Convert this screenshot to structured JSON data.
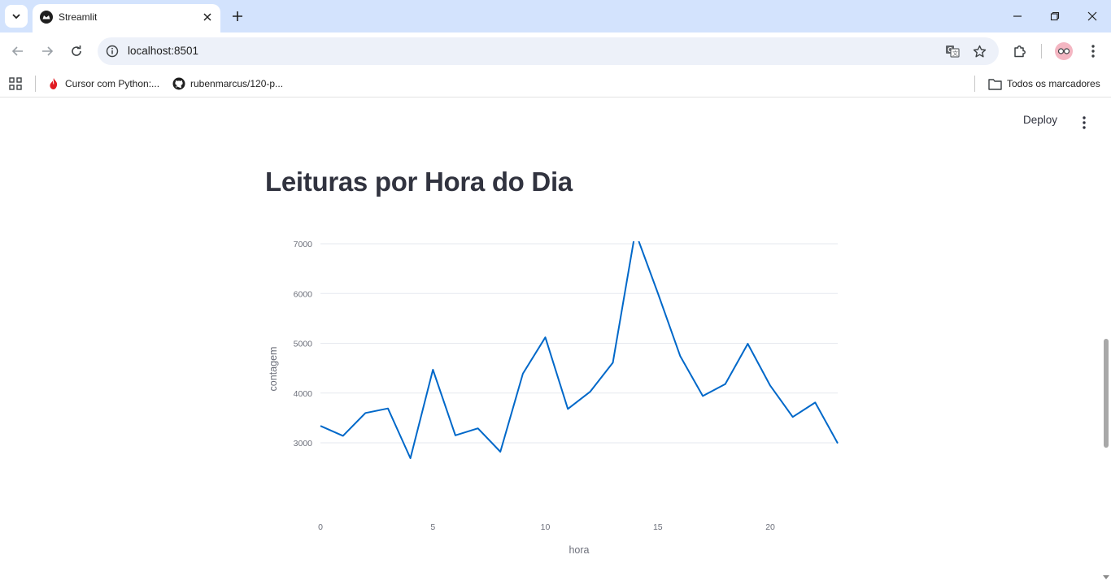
{
  "browser": {
    "tab_title": "Streamlit",
    "url": "localhost:8501",
    "bookmarks": [
      {
        "label": "Cursor com Python:..."
      },
      {
        "label": "rubenmarcus/120-p..."
      }
    ],
    "all_bookmarks_label": "Todos os marcadores"
  },
  "app": {
    "deploy_label": "Deploy",
    "title": "Leituras por Hora do Dia"
  },
  "colors": {
    "line": "#0068c9",
    "text": "#31333f",
    "tabstrip": "#d3e3fd"
  },
  "chart_data": {
    "type": "line",
    "xlabel": "hora",
    "ylabel": "contagem",
    "x": [
      0,
      1,
      2,
      3,
      4,
      5,
      6,
      7,
      8,
      9,
      10,
      11,
      12,
      13,
      14,
      15,
      16,
      17,
      18,
      19,
      20,
      21,
      22,
      23
    ],
    "values": [
      3340,
      3140,
      3600,
      3690,
      2690,
      4470,
      3150,
      3290,
      2820,
      4390,
      5120,
      3680,
      4030,
      4610,
      7240,
      6010,
      4740,
      3940,
      4180,
      4990,
      4150,
      3520,
      3810,
      2990
    ],
    "xticks": [
      0,
      5,
      10,
      15,
      20
    ],
    "yticks": [
      3000,
      4000,
      5000,
      6000,
      7000
    ],
    "xlim": [
      0,
      23
    ],
    "ylim": [
      2550,
      7400
    ],
    "grid": true
  }
}
